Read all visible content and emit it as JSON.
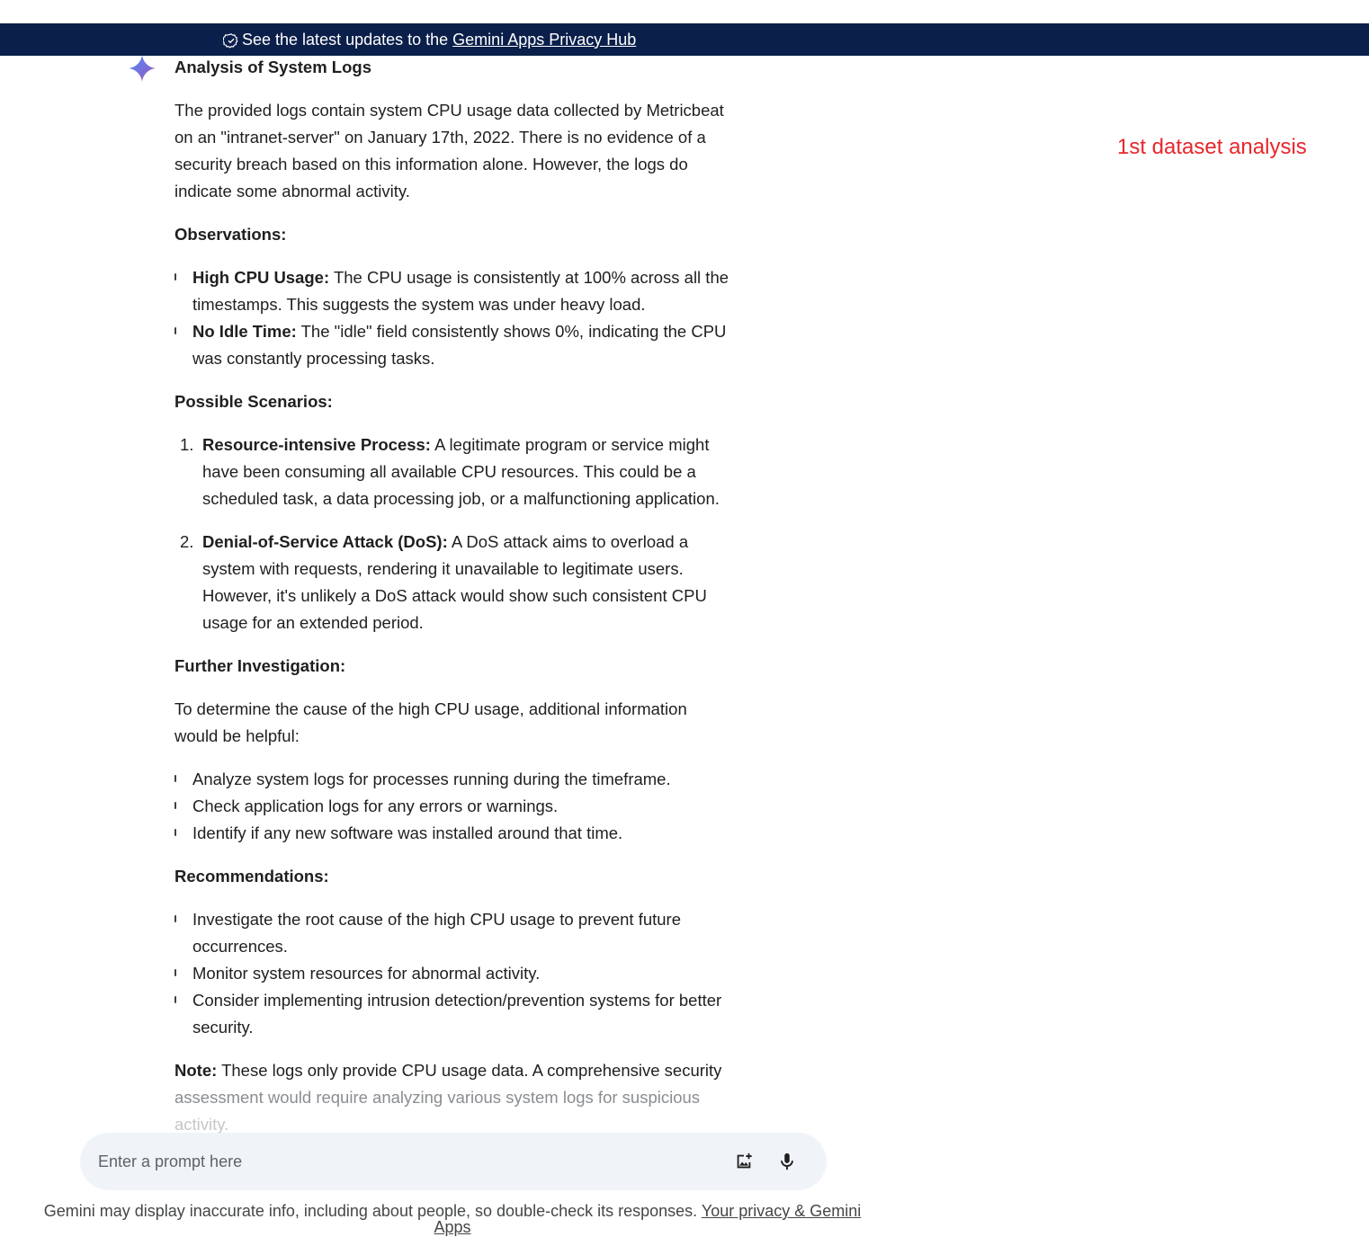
{
  "banner": {
    "text": "See the latest updates to the",
    "link": "Gemini Apps Privacy Hub"
  },
  "response": {
    "title": "Analysis of System Logs",
    "intro": "The provided logs contain system CPU usage data collected by Metricbeat on an \"intranet-server\" on January 17th, 2022. There is no evidence of a security breach based on this information alone. However, the logs do indicate some abnormal activity.",
    "observations": {
      "heading": "Observations:",
      "items": [
        {
          "label": "High CPU Usage:",
          "text": " The CPU usage is consistently at 100% across all the timestamps. This suggests the system was under heavy load."
        },
        {
          "label": "No Idle Time:",
          "text": " The \"idle\" field consistently shows 0%, indicating the CPU was constantly processing tasks."
        }
      ]
    },
    "scenarios": {
      "heading": "Possible Scenarios:",
      "items": [
        {
          "num": "1.",
          "label": "Resource-intensive Process:",
          "text": " A legitimate program or service might have been consuming all available CPU resources. This could be a scheduled task, a data processing job, or a malfunctioning application."
        },
        {
          "num": "2.",
          "label": "Denial-of-Service Attack (DoS):",
          "text": " A DoS attack aims to overload a system with requests, rendering it unavailable to legitimate users. However, it's unlikely a DoS attack would show such consistent CPU usage for an extended period."
        }
      ]
    },
    "investigation": {
      "heading": "Further Investigation:",
      "intro": "To determine the cause of the high CPU usage, additional information would be helpful:",
      "items": [
        "Analyze system logs for processes running during the timeframe.",
        "Check application logs for any errors or warnings.",
        "Identify if any new software was installed around that time."
      ]
    },
    "recommendations": {
      "heading": "Recommendations:",
      "items": [
        "Investigate the root cause of the high CPU usage to prevent future occurrences.",
        "Monitor system resources for abnormal activity.",
        "Consider implementing intrusion detection/prevention systems for better security."
      ]
    },
    "note": {
      "label": "Note:",
      "text_a": " These logs only provide CPU usage data. A comprehensive security",
      "text_b": " assessment would require analyzing various system logs for suspicious",
      "text_c": " activity."
    }
  },
  "annotation": "1st dataset analysis",
  "prompt": {
    "placeholder": "Enter a prompt here"
  },
  "footer": {
    "text": "Gemini may display inaccurate info, including about people, so double-check its responses.",
    "link": "Your privacy & Gemini Apps"
  },
  "colors": {
    "banner_bg": "#0b1f4b",
    "annotation": "#e8262b",
    "prompt_bg": "#f0f4f9"
  }
}
